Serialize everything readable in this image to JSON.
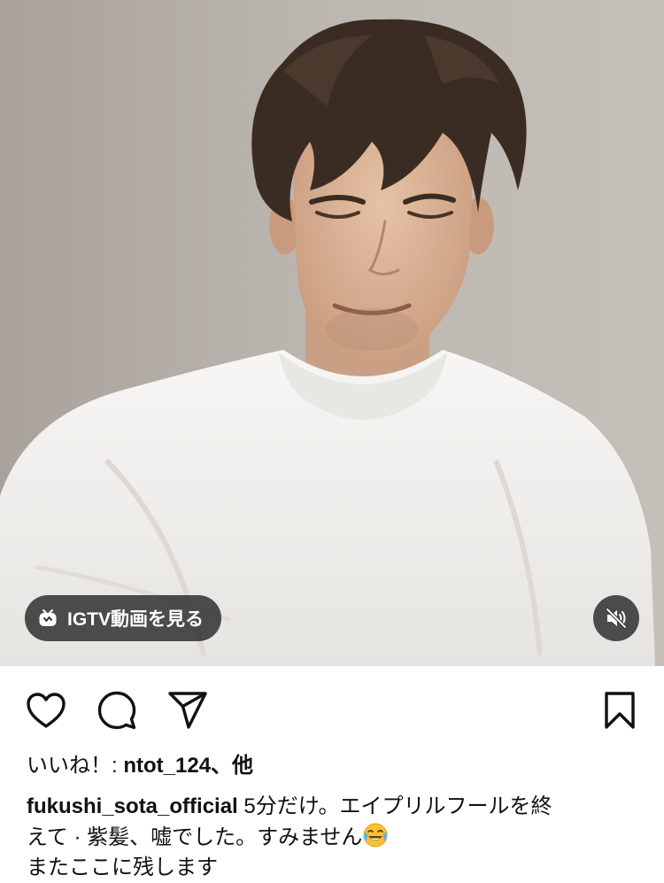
{
  "media": {
    "igtv_label": "IGTV動画を見る",
    "igtv_icon": "igtv-icon",
    "mute_icon": "speaker-muted-icon"
  },
  "actions": {
    "like_icon": "heart-icon",
    "comment_icon": "comment-bubble-icon",
    "share_icon": "paper-plane-icon",
    "save_icon": "bookmark-icon"
  },
  "likes": {
    "prefix": "いいね！: ",
    "user": "ntot_124",
    "suffix": "、他"
  },
  "caption": {
    "username": "fukushi_sota_official",
    "line1": " 5分だけ。エイプリルフールを終",
    "line2": "えて · 紫髪、嘘でした。すみません",
    "emoji": "face-with-tears-of-joy",
    "line3": "またここに残します"
  },
  "colors": {
    "wall": "#b9b3ad",
    "shirt": "#f4f3f1",
    "hair": "#3a2c22",
    "pill_bg": "#282828",
    "text": "#111111"
  }
}
